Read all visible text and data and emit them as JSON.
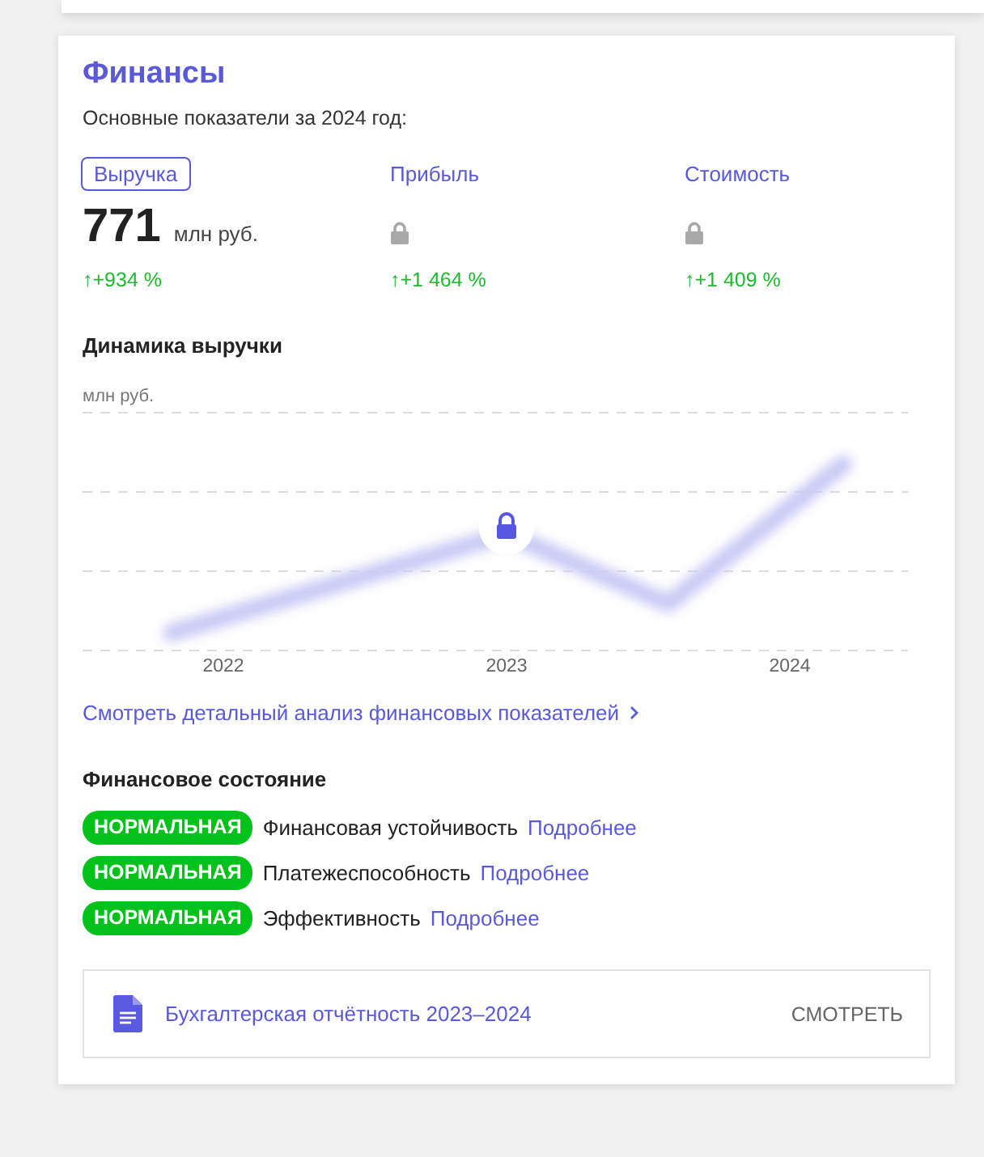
{
  "title": "Финансы",
  "subtitle": "Основные показатели за 2024 год:",
  "metrics": [
    {
      "label": "Выручка",
      "selected": true,
      "kind": "value",
      "value": "771",
      "unit": "млн руб.",
      "change": "↑+934 %"
    },
    {
      "label": "Прибыль",
      "selected": false,
      "kind": "locked",
      "change": "↑+1 464 %"
    },
    {
      "label": "Стоимость",
      "selected": false,
      "kind": "locked",
      "change": "↑+1 409 %"
    }
  ],
  "chart": {
    "title": "Динамика выручки",
    "unit": "млн руб.",
    "x_labels": [
      "2022",
      "2023",
      "2024"
    ],
    "locked": true
  },
  "analysis_link": "Смотреть детальный анализ финансовых показателей",
  "condition": {
    "title": "Финансовое состояние",
    "items": [
      {
        "status": "НОРМАЛЬНАЯ",
        "color": "#00c21a",
        "label": "Финансовая устойчивость",
        "link": "Подробнее"
      },
      {
        "status": "НОРМАЛЬНАЯ",
        "color": "#00c21a",
        "label": "Платежеспособность",
        "link": "Подробнее"
      },
      {
        "status": "НОРМАЛЬНАЯ",
        "color": "#00c21a",
        "label": "Эффективность",
        "link": "Подробнее"
      }
    ]
  },
  "report": {
    "title": "Бухгалтерская отчётность 2023–2024",
    "action": "СМОТРЕТЬ"
  }
}
